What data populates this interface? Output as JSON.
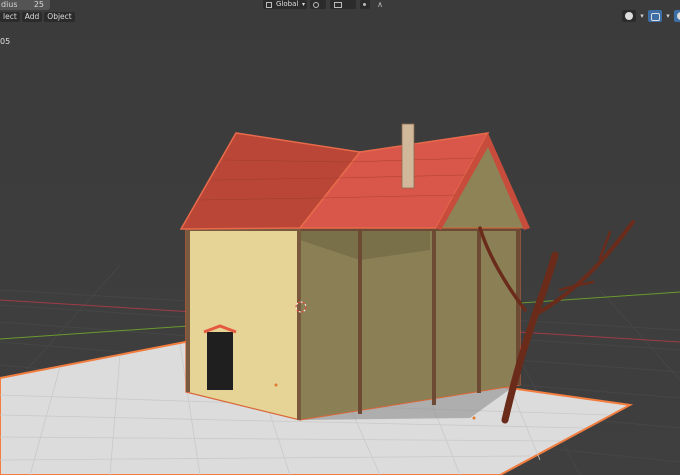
{
  "header": {
    "radius": {
      "label": "dius",
      "value": "25"
    },
    "menus": [
      {
        "label": "lect"
      },
      {
        "label": "Add"
      },
      {
        "label": "Object"
      }
    ],
    "orientation": {
      "label": "Global"
    },
    "falloff_symbol": "∧"
  },
  "viewport": {
    "overlay_text": "05"
  },
  "colors": {
    "background": "#3d3d3d",
    "ground": "#dedede",
    "wall": "#e6d497",
    "roof": "#c84c3b",
    "selection": "#f27d3e",
    "x_axis": "#a13b46",
    "y_axis": "#6a9a2f"
  },
  "icons": [
    "transform-orientation-icon",
    "pivot-icon",
    "snap-icon",
    "proportional-edit-icon",
    "viewport-gizmo-icon",
    "overlay-icon",
    "shading-icon"
  ]
}
